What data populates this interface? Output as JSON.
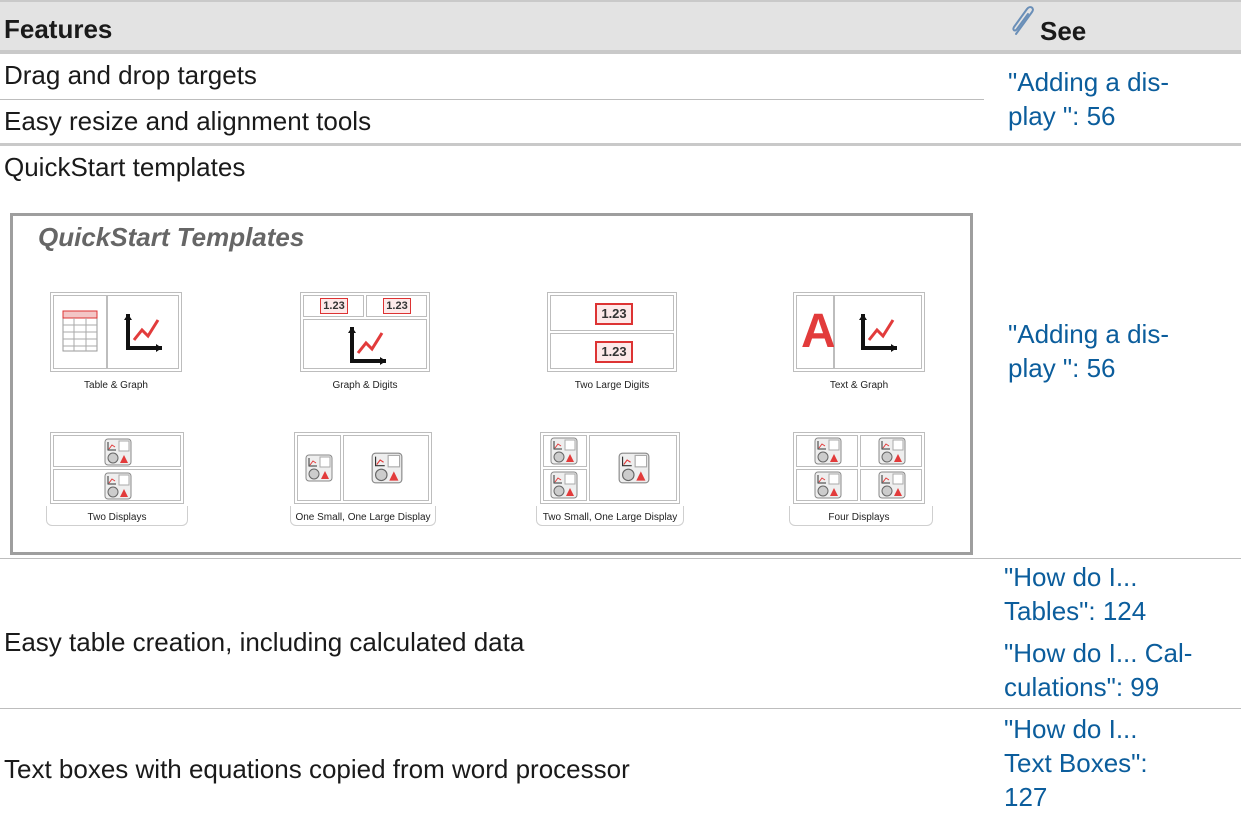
{
  "header": {
    "features": "Features",
    "see": "See",
    "see_icon": "paperclip-icon"
  },
  "rows": {
    "drag_drop": "Drag and drop targets",
    "resize": "Easy resize and alignment tools",
    "link_add_display_1": [
      "\"Adding a dis-",
      "play \":  56"
    ],
    "quickstart": "QuickStart templates",
    "link_add_display_2": [
      "\"Adding a dis-",
      "play \":  56"
    ],
    "table_creation": "Easy table creation, including calculated data",
    "link_tables": [
      "\"How do I...",
      "Tables\":  124"
    ],
    "link_calc": [
      "\"How do I... Cal-",
      "culations\":  99"
    ],
    "text_boxes": "Text boxes with equations copied from word processor",
    "link_text": [
      "\"How do I...",
      "Text Boxes\":",
      "127"
    ]
  },
  "quickstart_panel": {
    "title": "QuickStart Templates",
    "templates": [
      {
        "name": "Table & Graph"
      },
      {
        "name": "Graph & Digits",
        "digits": [
          "1.23",
          "1.23"
        ]
      },
      {
        "name": "Two Large Digits",
        "digits": [
          "1.23",
          "1.23"
        ]
      },
      {
        "name": "Text & Graph",
        "letter": "A"
      },
      {
        "name": "Two Displays"
      },
      {
        "name": "One Small, One Large Display"
      },
      {
        "name": "Two Small, One Large Display"
      },
      {
        "name": "Four Displays"
      }
    ]
  },
  "colors": {
    "link": "#0b5d9c",
    "header_bg": "#e3e3e3",
    "accent_red": "#e23b3b"
  }
}
